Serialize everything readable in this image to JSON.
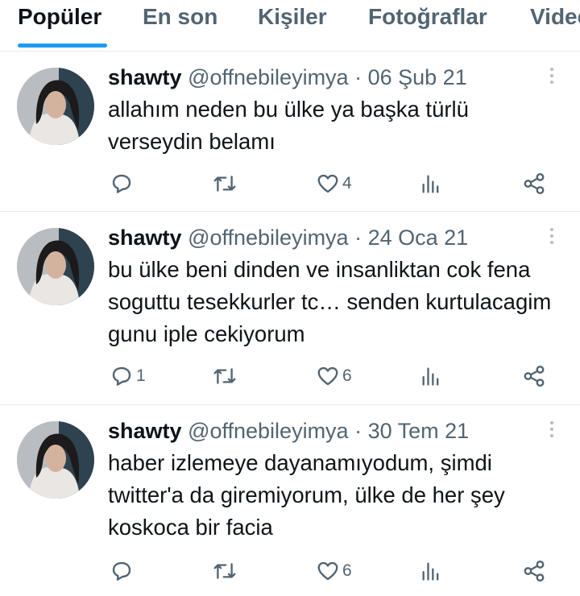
{
  "tabs": [
    {
      "label": "Popüler",
      "active": true
    },
    {
      "label": "En son",
      "active": false
    },
    {
      "label": "Kişiler",
      "active": false
    },
    {
      "label": "Fotoğraflar",
      "active": false
    },
    {
      "label": "Videolar",
      "active": false
    }
  ],
  "colors": {
    "accent": "#1d9bf0",
    "text": "#0f1419",
    "muted": "#536471",
    "divider": "#e6ecf0"
  },
  "tweets": [
    {
      "name": "shawty",
      "handle": "@offnebileyimya",
      "separator": "·",
      "date": "06 Şub 21",
      "text": "allahım neden bu ülke ya başka türlü verseydin belamı",
      "reply_count": "",
      "retweet_count": "",
      "like_count": "4"
    },
    {
      "name": "shawty",
      "handle": "@offnebileyimya",
      "separator": "·",
      "date": "24 Oca 21",
      "text": "bu ülke beni dinden ve insanliktan cok fena soguttu tesekkurler tc… senden kurtulacagim gunu iple cekiyorum",
      "reply_count": "1",
      "retweet_count": "",
      "like_count": "6"
    },
    {
      "name": "shawty",
      "handle": "@offnebileyimya",
      "separator": "·",
      "date": "30 Tem 21",
      "text": "haber izlemeye dayanamıyodum, şimdi twitter'a da giremiyorum, ülke de her şey koskoca bir facia",
      "reply_count": "",
      "retweet_count": "",
      "like_count": "6"
    }
  ],
  "icons": {
    "reply": "reply-icon",
    "retweet": "retweet-icon",
    "like": "heart-icon",
    "analytics": "analytics-icon",
    "share": "share-icon",
    "more": "more-vertical-icon"
  }
}
